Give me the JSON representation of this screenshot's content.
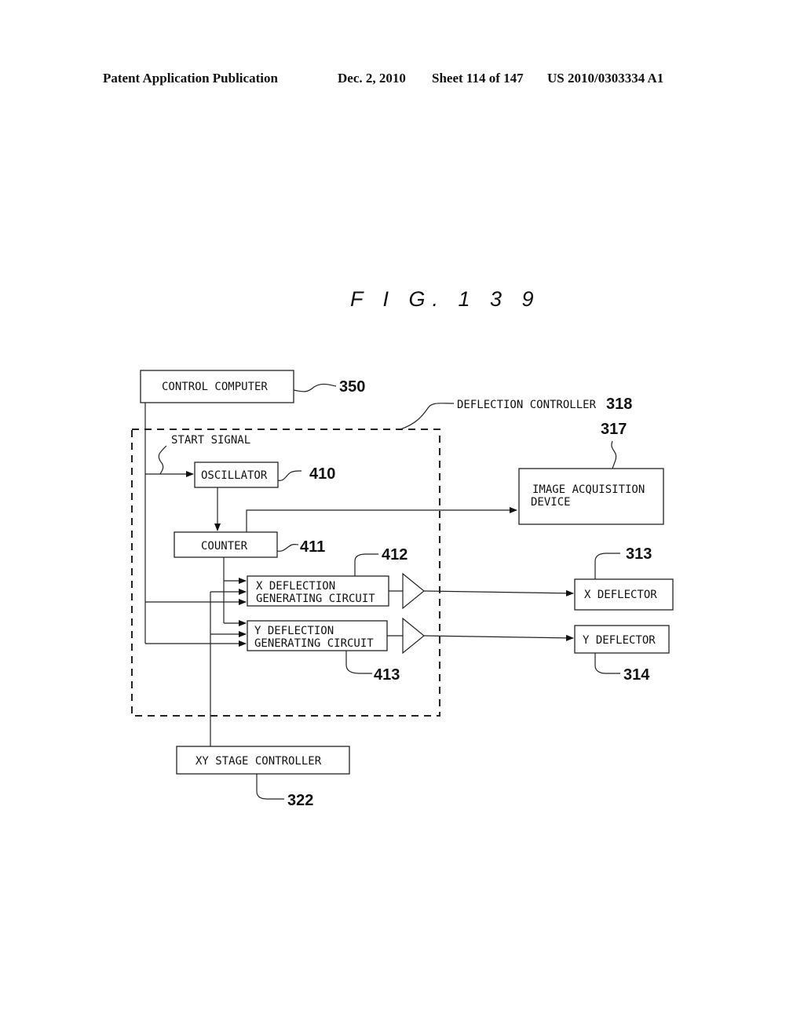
{
  "header": {
    "publication": "Patent Application Publication",
    "date": "Dec. 2, 2010",
    "sheet": "Sheet 114 of 147",
    "number": "US 2010/0303334 A1"
  },
  "figure": {
    "title": "F I G. 1 3 9"
  },
  "blocks": {
    "control_computer": {
      "label": "CONTROL COMPUTER",
      "ref": "350"
    },
    "deflection_controller": {
      "label": "DEFLECTION CONTROLLER",
      "ref": "318"
    },
    "start_signal": {
      "label": "START SIGNAL"
    },
    "oscillator": {
      "label": "OSCILLATOR",
      "ref": "410"
    },
    "counter": {
      "label": "COUNTER",
      "ref": "411"
    },
    "x_deflection": {
      "line1": "X DEFLECTION",
      "line2": "GENERATING CIRCUIT",
      "ref": "412"
    },
    "y_deflection": {
      "line1": "Y DEFLECTION",
      "line2": "GENERATING CIRCUIT",
      "ref": "413"
    },
    "image_acquisition": {
      "line1": "IMAGE ACQUISITION",
      "line2": "DEVICE",
      "ref": "317"
    },
    "x_deflector": {
      "label": "X DEFLECTOR",
      "ref": "313"
    },
    "y_deflector": {
      "label": "Y DEFLECTOR",
      "ref": "314"
    },
    "xy_stage_controller": {
      "label": "XY STAGE CONTROLLER",
      "ref": "322"
    }
  }
}
